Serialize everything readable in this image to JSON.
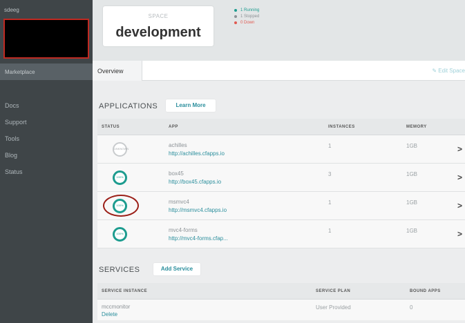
{
  "sidebar": {
    "org_label": "sdeeg",
    "marketplace": "Marketplace",
    "links": [
      "Docs",
      "Support",
      "Tools",
      "Blog",
      "Status"
    ]
  },
  "header": {
    "space_label": "SPACE",
    "space_name": "development",
    "statuses": [
      {
        "text": "1 Running",
        "color": "#1d9c8f"
      },
      {
        "text": "1 Stopped",
        "color": "#8d9296"
      },
      {
        "text": "0 Down",
        "color": "#e05a52"
      }
    ]
  },
  "tabs": {
    "overview": "Overview",
    "edit_space": "Edit Space"
  },
  "applications": {
    "title": "APPLICATIONS",
    "learn_more": "Learn More",
    "columns": [
      "STATUS",
      "APP",
      "INSTANCES",
      "MEMORY"
    ],
    "rows": [
      {
        "status": "UNKNOWN",
        "name": "achilles",
        "url": "http://achilles.cfapps.io",
        "instances": "1",
        "memory": "1GB"
      },
      {
        "status": "100%",
        "name": "box45",
        "url": "http://box45.cfapps.io",
        "instances": "3",
        "memory": "1GB"
      },
      {
        "status": "100%",
        "name": "msmvc4",
        "url": "http://msmvc4.cfapps.io",
        "instances": "1",
        "memory": "1GB"
      },
      {
        "status": "100%",
        "name": "mvc4-forms",
        "url": "http://mvc4-forms.cfap...",
        "instances": "1",
        "memory": "1GB"
      }
    ],
    "chevron": ">"
  },
  "services": {
    "title": "SERVICES",
    "add_service": "Add Service",
    "columns": [
      "SERVICE INSTANCE",
      "SERVICE PLAN",
      "BOUND APPS"
    ],
    "rows": [
      {
        "name": "mccmonitor",
        "action": "Delete",
        "plan": "User Provided",
        "bound_apps": "0"
      }
    ]
  },
  "colors": {
    "accent": "#2a8e9c",
    "ring": "#1d9c8f",
    "annotation": "#9b1f18",
    "sidebar": "#3f4548"
  }
}
